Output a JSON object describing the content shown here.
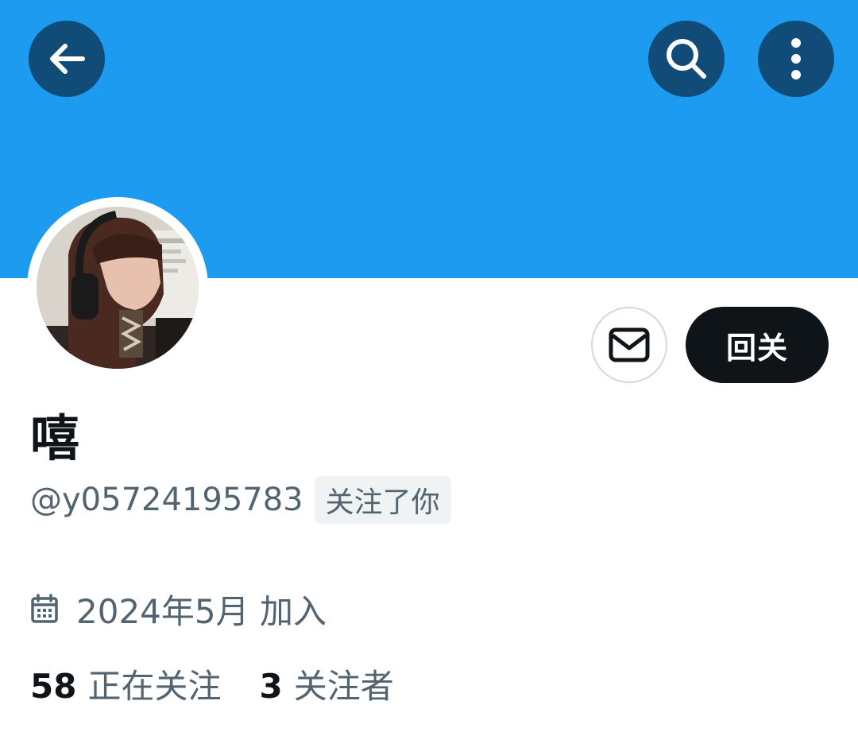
{
  "header": {
    "banner_color": "#1d9bf0",
    "buttons": [
      {
        "icon": "back-arrow-icon"
      },
      {
        "icon": "search-icon"
      },
      {
        "icon": "more-vertical-icon"
      }
    ]
  },
  "profile": {
    "display_name": "嘻",
    "handle": "@y05724195783",
    "follows_you_label": "关注了你",
    "joined_label": "2024年5月 加入",
    "following_count": "58",
    "following_label": "正在关注",
    "followers_count": "3",
    "followers_label": "关注者"
  },
  "actions": {
    "message_icon": "envelope-icon",
    "follow_back_label": "回关"
  },
  "colors": {
    "accent": "#1d9bf0",
    "header_button_bg": "#114b78",
    "primary_text": "#0f1419",
    "secondary_text": "#536471",
    "badge_bg": "#eff3f4"
  }
}
